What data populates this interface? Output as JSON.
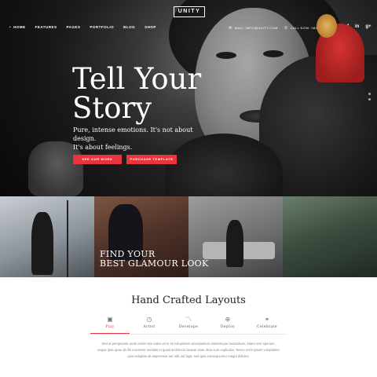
{
  "header": {
    "logo": "UNITY",
    "nav_items": [
      {
        "label": "HOME",
        "active": true
      },
      {
        "label": "FEATURES"
      },
      {
        "label": "PAGES"
      },
      {
        "label": "PORTFOLIO"
      },
      {
        "label": "BLOG"
      },
      {
        "label": "SHOP"
      }
    ],
    "email": "MAIL: INFO@UNITY.COM",
    "phone": "CALL NOW: 0800 456 789",
    "socials": [
      "twitter-icon",
      "facebook-icon",
      "linkedin-icon",
      "google-plus-icon"
    ]
  },
  "hero": {
    "headline_line1": "Tell Your",
    "headline_line2": "Story",
    "subtext_line1": "Pure, intense emotions. It's not about design.",
    "subtext_line2": "It's about feelings.",
    "primary_button": "SEE OUR WORK",
    "secondary_button": "PURCHASE TEMPLATE",
    "accent_color": "#e8343c"
  },
  "gallery": {
    "caption_line1": "FIND YOUR",
    "caption_line2": "BEST GLAMOUR LOOK"
  },
  "features": {
    "title": "Hand Crafted Layouts",
    "tabs": [
      {
        "label": "Play",
        "icon": "play-icon",
        "active": true
      },
      {
        "label": "Artist",
        "icon": "clock-icon"
      },
      {
        "label": "Develope",
        "icon": "chart-icon"
      },
      {
        "label": "Deploy",
        "icon": "globe-icon"
      },
      {
        "label": "Celebrate",
        "icon": "link-icon"
      }
    ],
    "body": "Sed ut perspiciatis unde omnis iste natus error sit voluptatem accusantium doloremque laudantium, totam rem aperiam, eaque ipsa quae ab illo inventore veritatis et quasi architecto beatae vitae dicta sunt explicabo. Nemo enim ipsam voluptatem quia voluptas sit aspernatur aut odit aut fugit, sed quia consequuntur magni dolores."
  }
}
